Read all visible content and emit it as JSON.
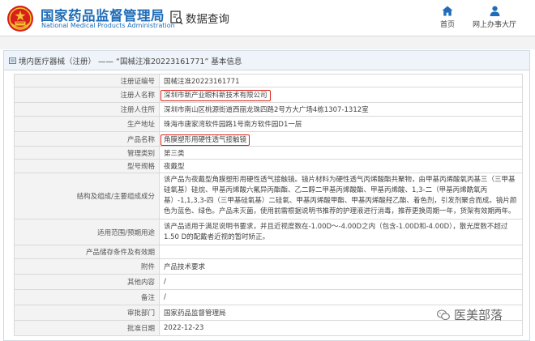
{
  "header": {
    "brand_cn": "国家药品监督管理局",
    "brand_en": "National Medical Products Administration",
    "query_label": "数据查询",
    "nav_home": "首页",
    "nav_service": "网上办事大厅"
  },
  "breadcrumb": "境内医疗器械（注册） —— “国械注准20223161771” 基本信息",
  "rows": [
    {
      "label": "注册证编号",
      "value": "国械注准20223161771"
    },
    {
      "label": "注册人名称",
      "value": "深圳市新产业眼科新技术有限公司"
    },
    {
      "label": "注册人住所",
      "value": "深圳市南山区桃源街道西丽龙珠四路2号方大广场4栋1307-1312室"
    },
    {
      "label": "生产地址",
      "value": "珠海市唐家湾软件园路1号南方软件园D1一层"
    },
    {
      "label": "产品名称",
      "value": "角膜塑形用硬性透气接触镜"
    },
    {
      "label": "管理类别",
      "value": "第三类"
    },
    {
      "label": "型号规格",
      "value": "夜戴型"
    },
    {
      "label": "结构及组成/主要组成成分",
      "value": "该产品为夜戴型角膜塑形用硬性透气接触镜。镜片材料为硬性透气丙烯酸酯共聚物，由甲基丙烯酸氧丙基三（三甲基硅氧基）硅烷、甲基丙烯酸六氟异丙酯酯、乙二醇二甲基丙烯酸酯、甲基丙烯酸、1,3-二（甲基丙烯酰氧丙基）-1,1,3,3-四（三甲基硅氧基）二硅氧、甲基丙烯酸甲酯、甲基丙烯酸羟乙酯、着色剂，引发剂聚合而成。镜片颜色为蓝色、绿色。产品未灭菌，使用前需根据说明书推荐的护理液进行消毒，推荐更换周期一年，货架有效期两年。"
    },
    {
      "label": "适用范围/预期用途",
      "value": "该产品适用于满足说明书要求，并且近视度数在-1.00D～-4.00D之内（包含-1.00D和-4.00D），散光度数不超过1.50 D的配戴者近视的暂时矫正。"
    },
    {
      "label": "产品储存条件及有效期",
      "value": ""
    },
    {
      "label": "附件",
      "value": "产品技术要求"
    },
    {
      "label": "其他内容",
      "value": "/"
    },
    {
      "label": "备注",
      "value": "/"
    },
    {
      "label": "审批部门",
      "value": "国家药品监督管理局"
    },
    {
      "label": "批准日期",
      "value": "2022-12-23"
    }
  ],
  "watermark": {
    "icon": "wechat-icon",
    "text": "医美部落"
  },
  "colors": {
    "brand": "#1f6db8",
    "highlight": "#d9231a",
    "label_bg": "#f3f3f3",
    "breadcrumb_bg": "#eef4fa"
  }
}
